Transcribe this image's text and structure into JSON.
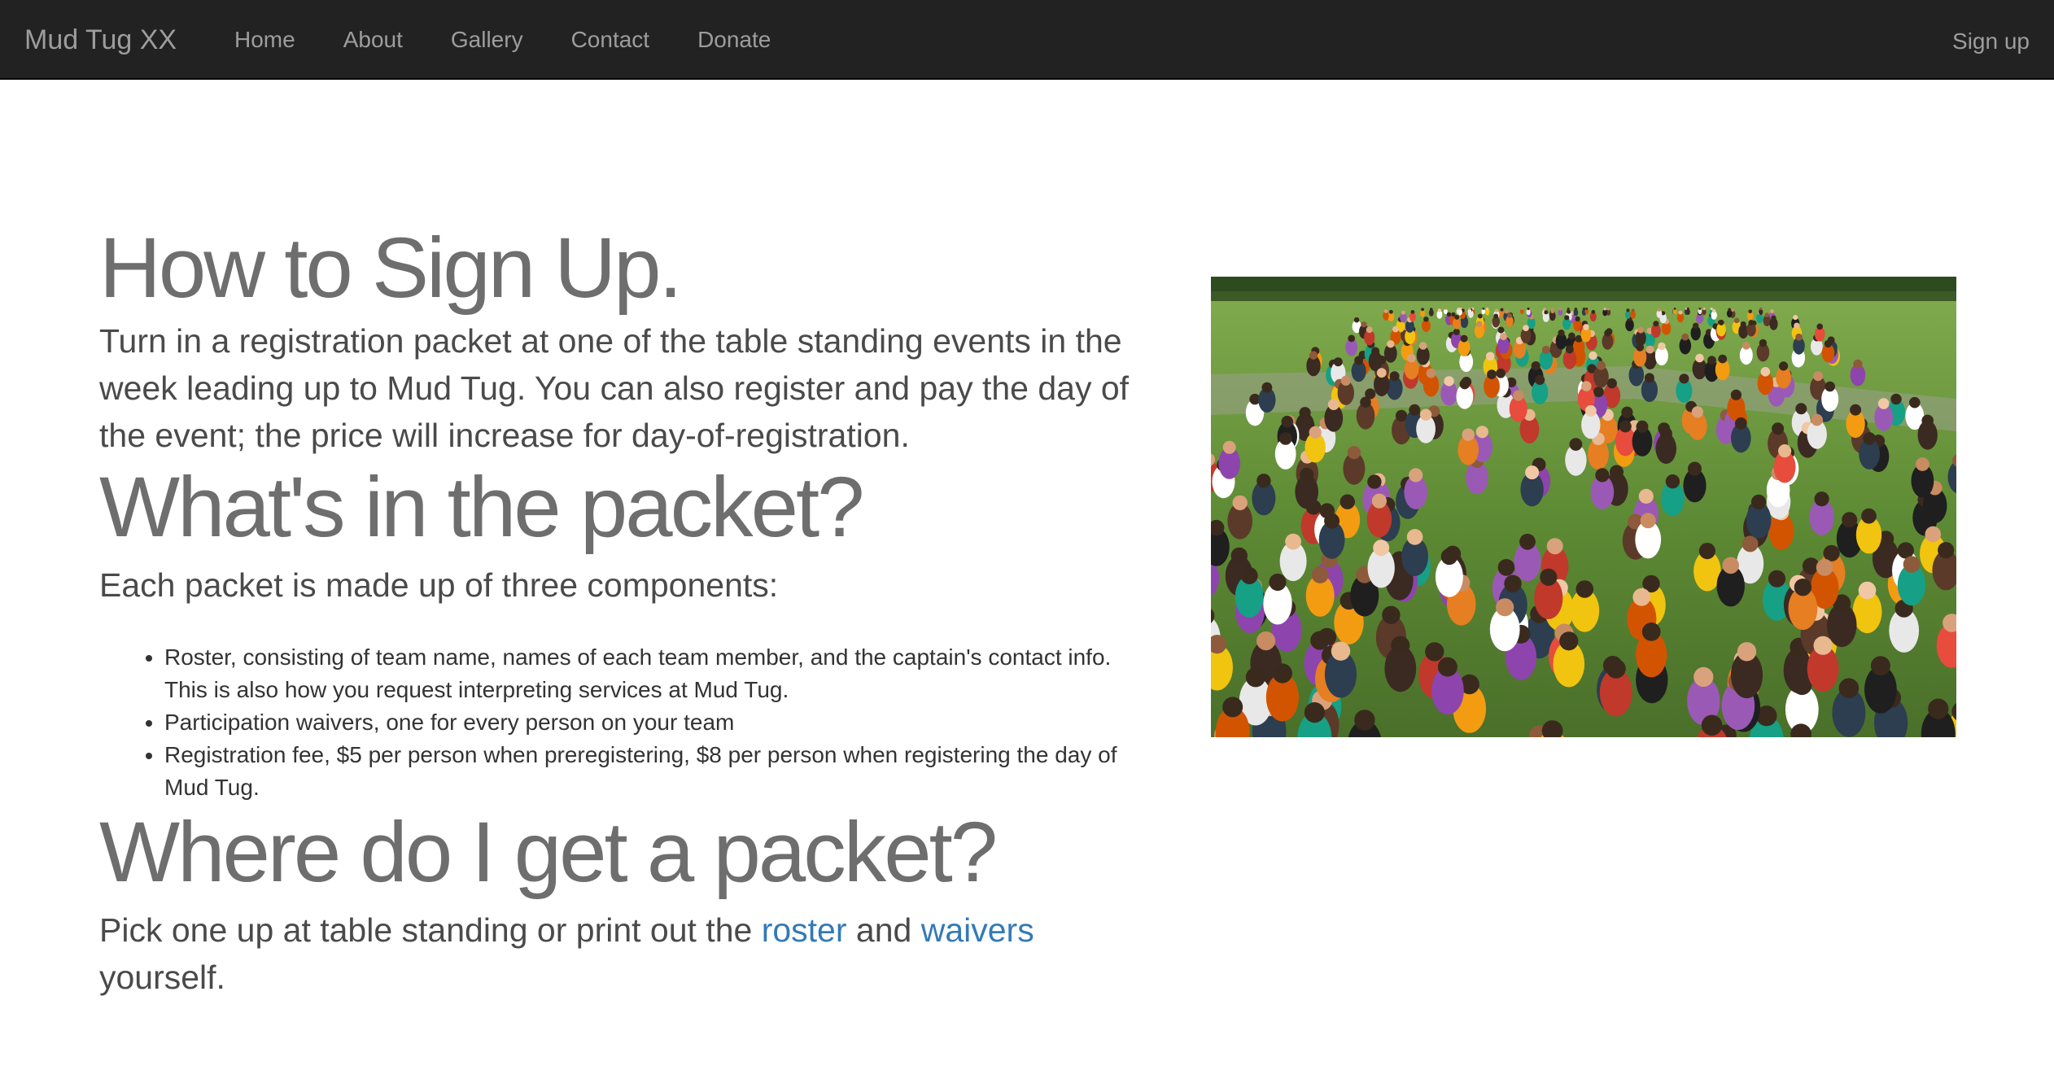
{
  "navbar": {
    "brand": "Mud Tug XX",
    "links": [
      "Home",
      "About",
      "Gallery",
      "Contact",
      "Donate"
    ],
    "signup": "Sign up"
  },
  "main": {
    "heading1": "How to Sign Up.",
    "para1": "Turn in a registration packet at one of the table standing events in the week leading up to Mud Tug. You can also register and pay the day of the event; the price will increase for day-of-registration.",
    "heading2": "What's in the packet?",
    "para2": "Each packet is made up of three components:",
    "packet_items": [
      "Roster, consisting of team name, names of each team member, and the captain's contact info. This is also how you request interpreting services at Mud Tug.",
      "Participation waivers, one for every person on your team",
      "Registration fee, $5 per person when preregistering, $8 per person when registering the day of Mud Tug."
    ],
    "heading3": "Where do I get a packet?",
    "para3_before": "Pick one up at table standing or print out the ",
    "roster_link": "roster",
    "para3_middle": " and ",
    "waivers_link": "waivers",
    "para3_after": " yourself."
  },
  "colors": {
    "navbar_bg": "#222222",
    "nav_text": "#9d9d9d",
    "heading_text": "#6e6e6e",
    "link": "#337ab7"
  }
}
